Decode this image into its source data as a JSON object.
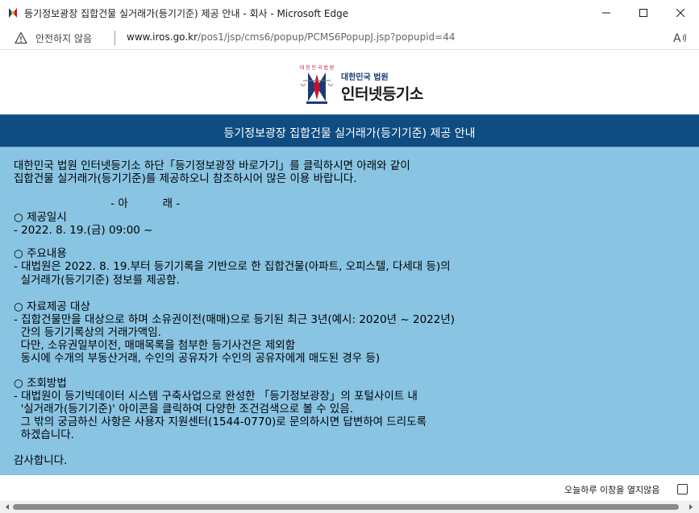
{
  "window": {
    "title": "등기정보광장 집합건물 실거래가(등기기준) 제공 안내 - 회사 - Microsoft Edge",
    "favicon": "court-emblem-icon"
  },
  "addressbar": {
    "security_label": "안전하지 않음",
    "url_host": "www.iros.go.kr",
    "url_path": "/pos1/jsp/cms6/popup/PCMS6PopupJ.jsp?popupid=44"
  },
  "logo": {
    "emblem_text": "대 한 민 국 법 원",
    "sub": "대한민국 법원",
    "main": "인터넷등기소"
  },
  "header": {
    "title": "등기정보광장 집합건물 실거래가(등기기준) 제공 안내"
  },
  "body": {
    "lines": [
      "대한민국 법원 인터넷등기소 하단「등기정보광장 바로가기」를 클릭하시면 아래와 같이",
      "집합건물 실거래가(등기기준)를 제공하오니 참조하시어 많은 이용 바랍니다.",
      "                            - 아          래 -",
      "○ 제공일시",
      "- 2022. 8. 19.(금) 09:00 ~",
      "○ 주요내용",
      "- 대법원은 2022. 8. 19.부터 등기기록을 기반으로 한 집합건물(아파트, 오피스텔, 다세대 등)의",
      "  실거래가(등기기준) 정보를 제공함.",
      "○ 자료제공 대상",
      "- 집합건물만을 대상으로 하며 소유권이전(매매)으로 등기된 최근 3년(예시: 2020년 ~ 2022년)",
      "  간의 등기기록상의 거래가액임.",
      "  다만, 소유권일부이전, 매매목록을 첨부한 등기사건은 제외함",
      "  동시에 수개의 부동산거래, 수인의 공유자가 수인의 공유자에게 매도된 경우 등)",
      "○ 조회방법",
      "- 대법원이 등기빅데이터 시스템 구축사업으로 완성한 「등기정보광장」의 포털사이트 내",
      "  '실거래가(등기기준)' 아이콘을 클릭하여 다양한 조건검색으로 볼 수 있음.",
      "  그 밖의 궁금하신 사항은 사용자 지원센터(1544-0770)로 문의하시면 답변하여 드리도록",
      "  하겠습니다.",
      "감사합니다."
    ]
  },
  "footer": {
    "checkbox_label": "오늘하루 이창을 열지않음"
  },
  "colors": {
    "header_band": "#0f4c81",
    "body_background": "#89c4e3"
  }
}
